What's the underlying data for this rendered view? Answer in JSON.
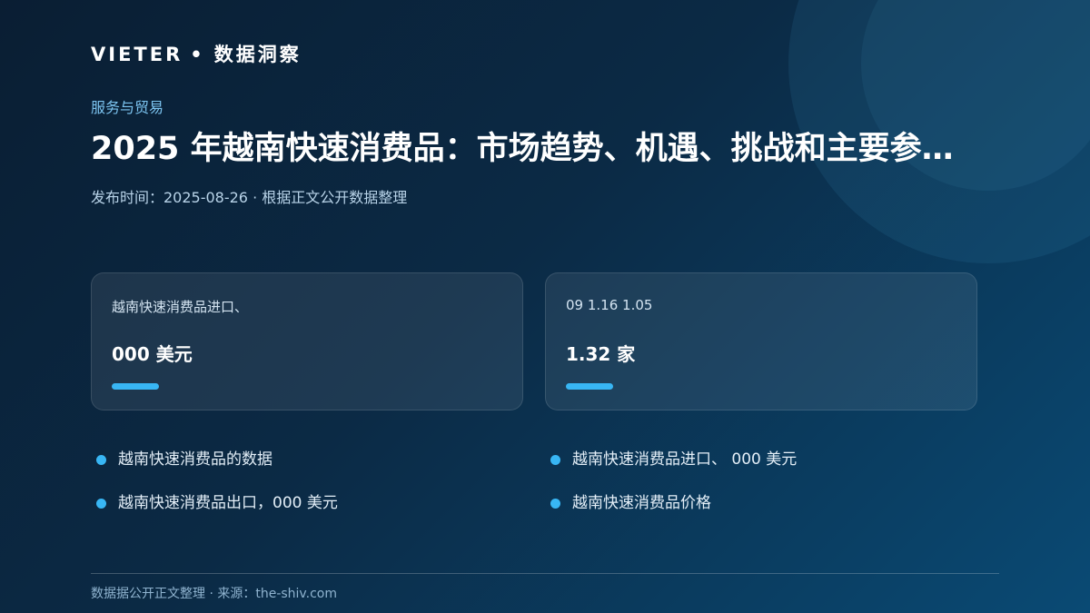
{
  "brand": {
    "name": "VIETER",
    "separator": "•",
    "section": "数据洞察"
  },
  "category": "服务与贸易",
  "title": "2025 年越南快速消费品：市场趋势、机遇、挑战和主要参…",
  "meta": "发布时间：2025-08-26 · 根据正文公开数据整理",
  "cards": [
    {
      "label": "越南快速消费品进口、",
      "value": "000 美元"
    },
    {
      "label": "09 1.16 1.05",
      "value": "1.32 家"
    }
  ],
  "bullets": [
    "越南快速消费品的数据",
    "越南快速消费品进口、 000 美元",
    "越南快速消费品出口，000 美元",
    "越南快速消费品价格"
  ],
  "footer": "数据据公开正文整理 · 来源：the-shiv.com",
  "colors": {
    "accent": "#38b6f4",
    "category_text": "#7cc4f0",
    "background_start": "#0a1e33",
    "background_end": "#0a4a74"
  }
}
